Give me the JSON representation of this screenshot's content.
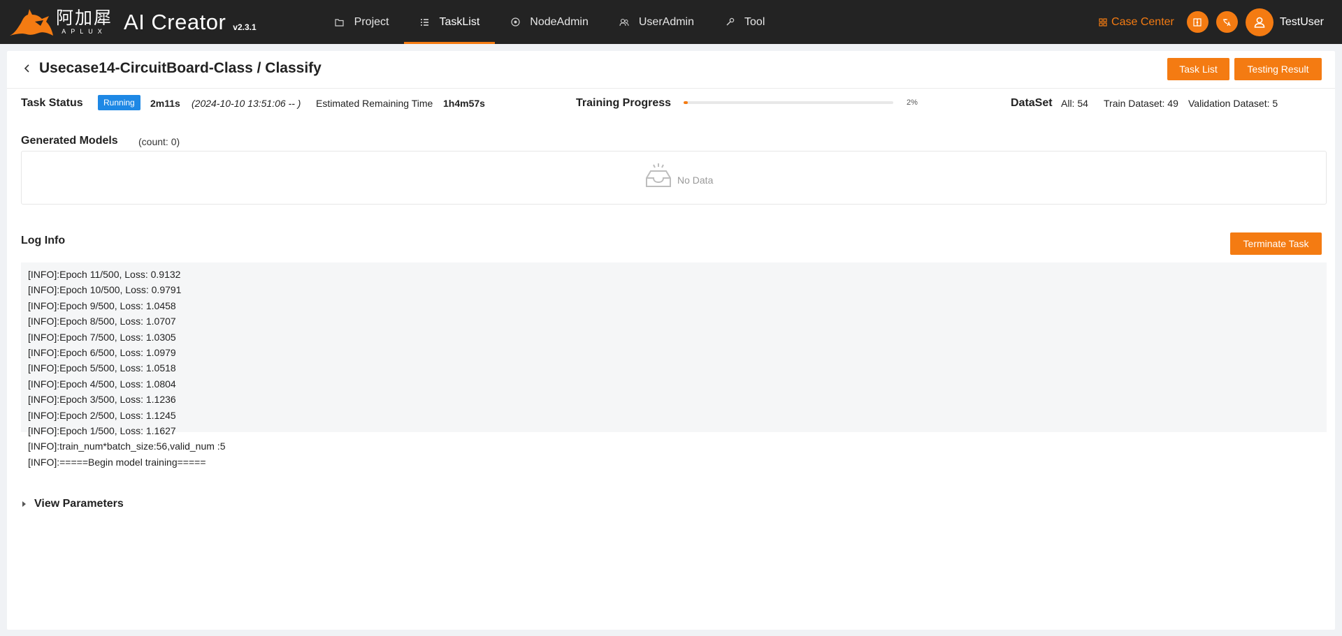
{
  "brand": {
    "logo_cn": "阿加犀",
    "logo_en": "APLUX",
    "product": "AI Creator",
    "version": "v2.3.1",
    "accent": "#f47b12"
  },
  "nav": {
    "items": [
      {
        "label": "Project",
        "icon": "folder-icon"
      },
      {
        "label": "TaskList",
        "icon": "list-icon",
        "active": true
      },
      {
        "label": "NodeAdmin",
        "icon": "node-icon"
      },
      {
        "label": "UserAdmin",
        "icon": "users-icon"
      },
      {
        "label": "Tool",
        "icon": "wrench-icon"
      }
    ]
  },
  "topright": {
    "case_center": "Case Center",
    "username": "TestUser"
  },
  "page": {
    "title": "Usecase14-CircuitBoard-Class / Classify",
    "task_list_btn": "Task List",
    "testing_result_btn": "Testing Result"
  },
  "status": {
    "task_status_label": "Task Status",
    "badge": "Running",
    "elapsed": "2m11s",
    "start_time": "(2024-10-10 13:51:06 -- )",
    "remaining_label": "Estimated Remaining Time",
    "remaining": "1h4m57s",
    "badge_color": "#1e88e5"
  },
  "training": {
    "label": "Training Progress",
    "percent": 2,
    "percent_text": "2%"
  },
  "dataset": {
    "label": "DataSet",
    "all": "All: 54",
    "train": "Train Dataset: 49",
    "validation": "Validation Dataset: 5"
  },
  "models": {
    "title": "Generated Models",
    "count": "(count:  0)",
    "no_data": "No Data"
  },
  "log": {
    "title": "Log Info",
    "terminate_btn": "Terminate Task",
    "lines": [
      "[INFO]:Epoch 11/500, Loss: 0.9132",
      "[INFO]:Epoch 10/500, Loss: 0.9791",
      "[INFO]:Epoch 9/500, Loss: 1.0458",
      "[INFO]:Epoch 8/500, Loss: 1.0707",
      "[INFO]:Epoch 7/500, Loss: 1.0305",
      "[INFO]:Epoch 6/500, Loss: 1.0979",
      "[INFO]:Epoch 5/500, Loss: 1.0518",
      "[INFO]:Epoch 4/500, Loss: 1.0804",
      "[INFO]:Epoch 3/500, Loss: 1.1236",
      "[INFO]:Epoch 2/500, Loss: 1.1245",
      "[INFO]:Epoch 1/500, Loss: 1.1627",
      "[INFO]:train_num*batch_size:56,valid_num :5",
      "[INFO]:=====Begin model training====="
    ]
  },
  "params": {
    "label": "View Parameters"
  }
}
